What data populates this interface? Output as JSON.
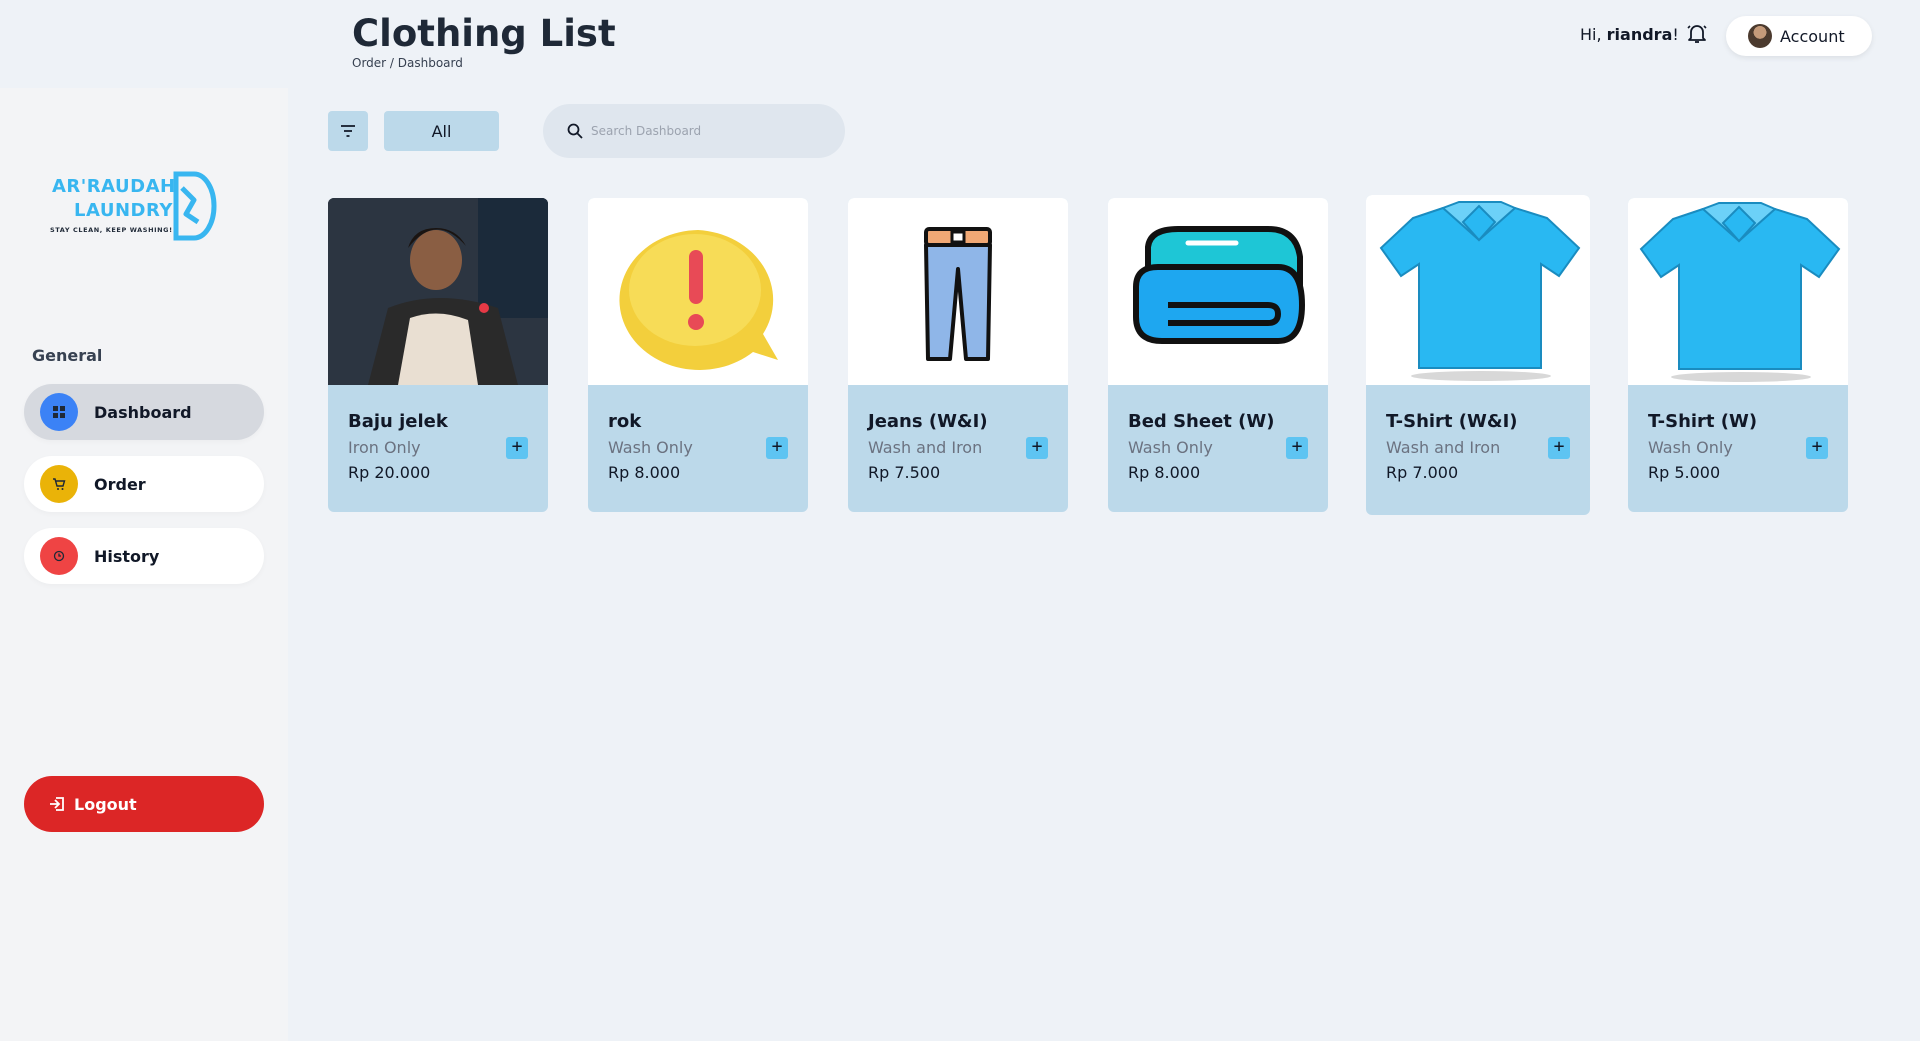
{
  "header": {
    "title": "Clothing List",
    "breadcrumb": "Order / Dashboard",
    "greeting_prefix": "Hi, ",
    "username": "riandra",
    "greeting_suffix": "!",
    "account_label": "Account"
  },
  "logo": {
    "line1": "AR'RAUDAH",
    "line2": "LAUNDRY",
    "tagline": "STAY CLEAN, KEEP WASHING!"
  },
  "sidebar": {
    "section_label": "General",
    "items": [
      {
        "label": "Dashboard",
        "icon": "grid-icon",
        "color": "#3b82f6",
        "active": true
      },
      {
        "label": "Order",
        "icon": "cart-icon",
        "color": "#eab308",
        "active": false
      },
      {
        "label": "History",
        "icon": "clock-icon",
        "color": "#ef4444",
        "active": false
      }
    ],
    "logout_label": "Logout"
  },
  "toolbar": {
    "filter_all_label": "All",
    "search_placeholder": "Search Dashboard"
  },
  "cards": [
    {
      "name": "Baju jelek",
      "service": "Iron Only",
      "price": "Rp 20.000",
      "image": "photo"
    },
    {
      "name": "rok",
      "service": "Wash Only",
      "price": "Rp 8.000",
      "image": "exclamation-icon"
    },
    {
      "name": "Jeans (W&I)",
      "service": "Wash and Iron",
      "price": "Rp 7.500",
      "image": "jeans-icon"
    },
    {
      "name": "Bed Sheet (W)",
      "service": "Wash Only",
      "price": "Rp 8.000",
      "image": "folded-sheet-icon"
    },
    {
      "name": "T-Shirt (W&I)",
      "service": "Wash and Iron",
      "price": "Rp 7.000",
      "image": "tshirt-icon"
    },
    {
      "name": "T-Shirt (W)",
      "service": "Wash Only",
      "price": "Rp 5.000",
      "image": "tshirt-icon"
    }
  ],
  "colors": {
    "accent": "#38b6f0",
    "card_bg": "#bcd9ea",
    "logout": "#dc2626",
    "add_button": "#5ec4f2"
  }
}
